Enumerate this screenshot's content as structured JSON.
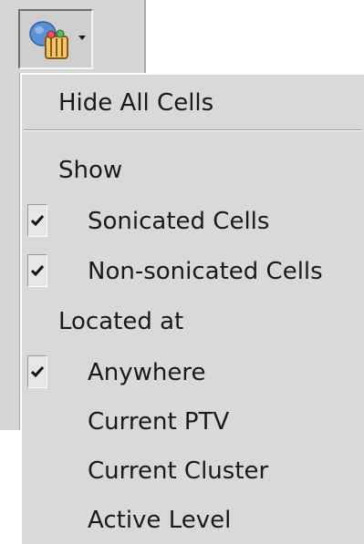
{
  "toolbar": {
    "button_icon": "cells-icon",
    "dropdown_icon": "chevron-down-icon"
  },
  "menu": {
    "hide_all": "Hide All Cells",
    "show_header": "Show",
    "show_items": [
      {
        "label": "Sonicated Cells",
        "checked": true
      },
      {
        "label": "Non-sonicated Cells",
        "checked": true
      }
    ],
    "located_header": "Located at",
    "located_items": [
      {
        "label": "Anywhere",
        "checked": true
      },
      {
        "label": "Current PTV",
        "checked": false
      },
      {
        "label": "Current Cluster",
        "checked": false
      },
      {
        "label": "Active Level",
        "checked": false
      }
    ]
  }
}
